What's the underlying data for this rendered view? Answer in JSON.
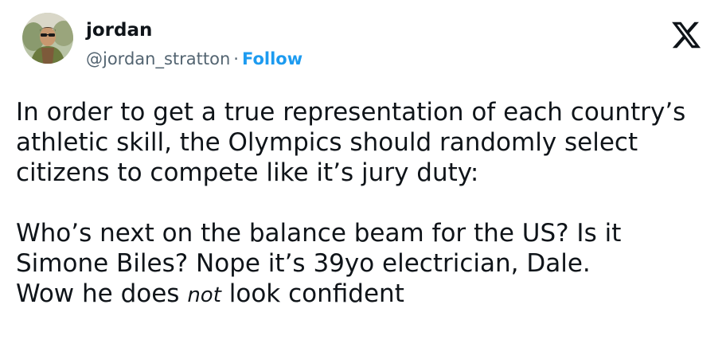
{
  "author": {
    "display_name": "jordan",
    "handle": "@jordan_stratton",
    "separator": "·",
    "follow_label": "Follow"
  },
  "brand": {
    "logo_icon": "x-logo-icon",
    "follow_color": "#1d9bf0"
  },
  "tweet": {
    "paragraph1": "In order to get a true representation of each country’s athletic skill, the Olympics should randomly select citizens to compete like it’s jury duty:",
    "paragraph2_lines": [
      "Who’s next on the balance beam for the US? Is it",
      "Simone Biles? Nope it’s 39yo electrician, Dale."
    ],
    "line3_before": "Wow he does ",
    "line3_emphasis": "not",
    "line3_after": " look confident"
  }
}
